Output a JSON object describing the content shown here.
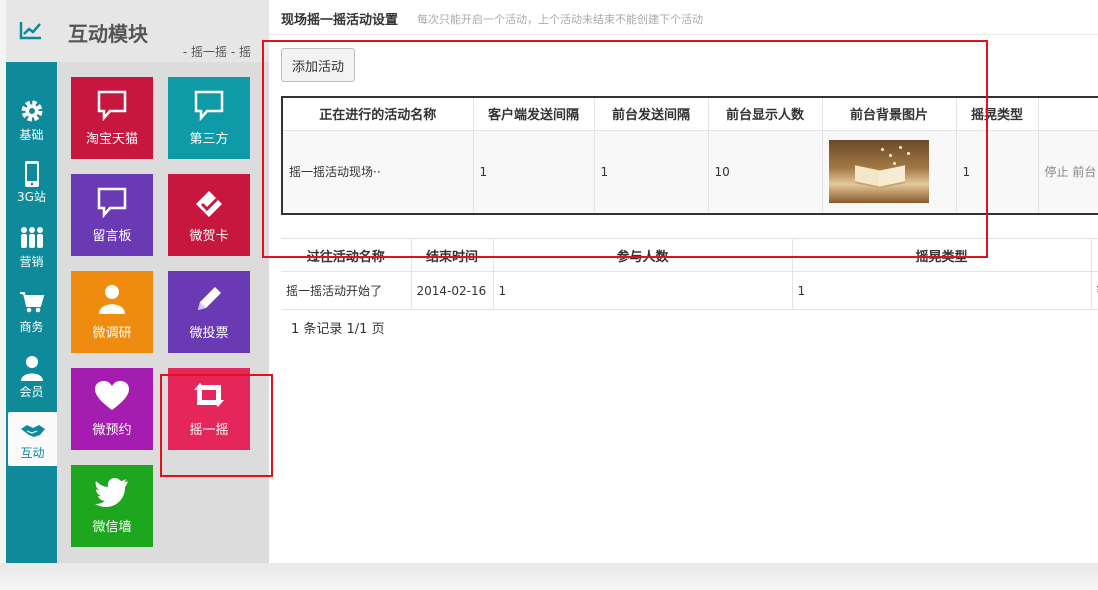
{
  "sidebar": {
    "items": [
      {
        "label": "基础",
        "icon": "gear-icon"
      },
      {
        "label": "3G站",
        "icon": "phone-icon"
      },
      {
        "label": "营销",
        "icon": "people-icon"
      },
      {
        "label": "商务",
        "icon": "cart-icon"
      },
      {
        "label": "会员",
        "icon": "user-icon"
      },
      {
        "label": "互动",
        "icon": "handshake-icon"
      }
    ]
  },
  "module": {
    "title": "互动模块",
    "breadcrumb": "- 摇一摇 - 摇",
    "tiles": [
      {
        "label": "淘宝天猫",
        "color": "#c8173f",
        "icon": "speech-bubble-icon"
      },
      {
        "label": "第三方",
        "color": "#0f9aa8",
        "icon": "speech-bubble-icon"
      },
      {
        "label": "留言板",
        "color": "#6a3ab5",
        "icon": "speech-bubble-icon"
      },
      {
        "label": "微贺卡",
        "color": "#c8173f",
        "icon": "card-check-icon"
      },
      {
        "label": "微调研",
        "color": "#ef8c10",
        "icon": "person-icon"
      },
      {
        "label": "微投票",
        "color": "#6a3ab5",
        "icon": "pencil-icon"
      },
      {
        "label": "微预约",
        "color": "#a51db0",
        "icon": "heart-icon"
      },
      {
        "label": "摇一摇",
        "color": "#e5265a",
        "icon": "retweet-icon"
      },
      {
        "label": "微信墙",
        "color": "#1ea61e",
        "icon": "twitter-bird-icon"
      }
    ]
  },
  "main": {
    "title": "现场摇一摇活动设置",
    "hint": "每次只能开启一个活动，上个活动未结束不能创建下个活动",
    "add_button": "添加活动",
    "current_table": {
      "headers": [
        "正在进行的活动名称",
        "客户端发送间隔",
        "前台发送间隔",
        "前台显示人数",
        "前台背景图片",
        "摇晃类型"
      ],
      "row": {
        "name": "摇一摇活动现场··",
        "client_interval": "1",
        "front_interval": "1",
        "display_count": "10",
        "shake_type": "1",
        "actions": "停止 前台"
      }
    },
    "past_table": {
      "headers": [
        "过往活动名称",
        "结束时间",
        "参与人数",
        "摇晃类型"
      ],
      "rows": [
        {
          "name": "摇一摇活动开始了",
          "end_time": "2014-02-16",
          "participants": "1",
          "shake_type": "1",
          "extra": "¥"
        }
      ]
    },
    "pager": "1 条记录 1/1 页"
  },
  "colors": {
    "rail": "#0f8a9a",
    "highlight": "#e0121c"
  }
}
